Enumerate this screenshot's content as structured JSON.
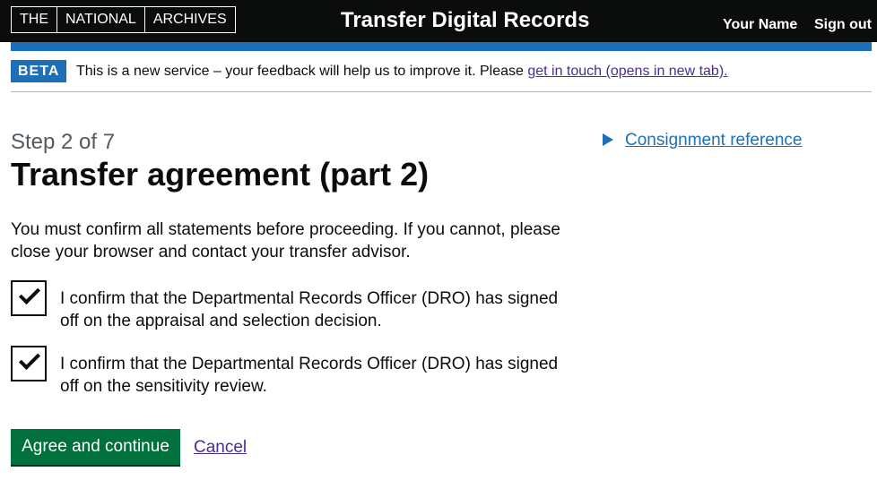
{
  "header": {
    "logo_parts": [
      "THE",
      "NATIONAL",
      "ARCHIVES"
    ],
    "service_name": "Transfer Digital Records",
    "user_name": "Your Name",
    "sign_out": "Sign out"
  },
  "phase_banner": {
    "tag": "BETA",
    "text": "This is a new service – your feedback will help us to improve it. Please ",
    "link": "get in touch (opens in new tab)."
  },
  "main": {
    "step": "Step 2 of 7",
    "title": "Transfer agreement (part 2)",
    "intro": "You must confirm all statements before proceeding. If you cannot, please close your browser and contact your transfer advisor.",
    "checkboxes": [
      {
        "label": "I confirm that the Departmental Records Officer (DRO) has signed off on the appraisal and selection decision.",
        "checked": true
      },
      {
        "label": "I confirm that the Departmental Records Officer (DRO) has signed off on the sensitivity review.",
        "checked": true
      }
    ],
    "primary_button": "Agree and continue",
    "cancel": "Cancel"
  },
  "sidebar": {
    "details_summary": "Consignment reference",
    "details_icon": "triangle-right-icon"
  },
  "colors": {
    "header_bg": "#0b0c0c",
    "accent_blue": "#1d70b8",
    "button_green": "#00703c",
    "visited_link": "#4c2c92"
  }
}
